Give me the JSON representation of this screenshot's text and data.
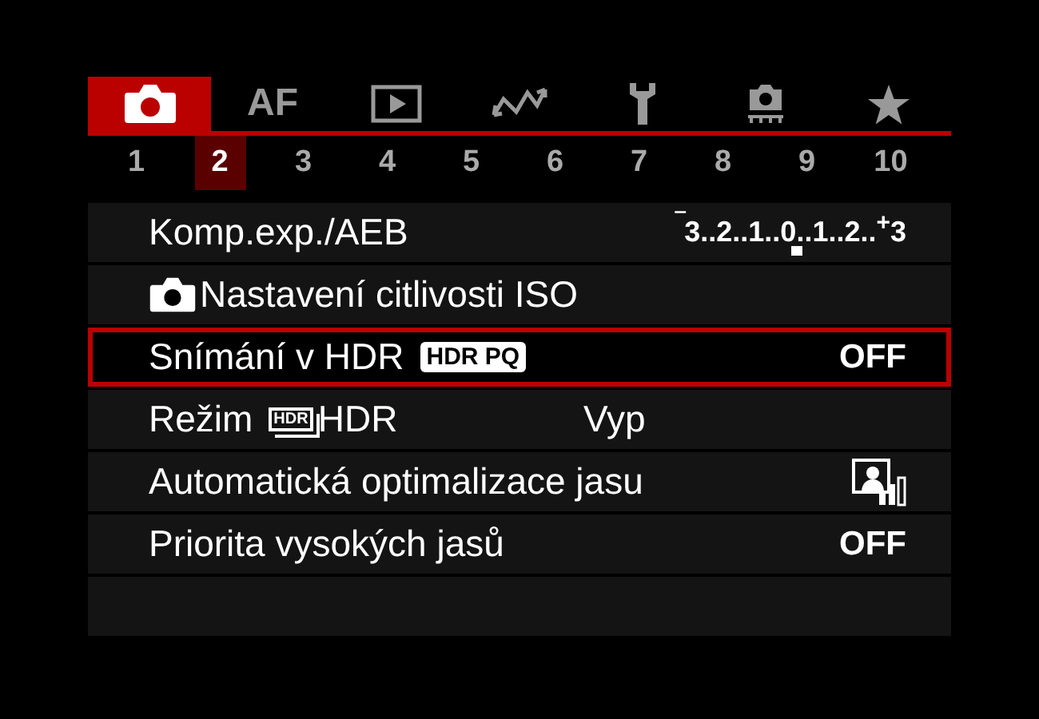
{
  "tabs": [
    {
      "kind": "camera",
      "selected": true
    },
    {
      "kind": "text",
      "label": "AF",
      "selected": false
    },
    {
      "kind": "play",
      "selected": false
    },
    {
      "kind": "wave",
      "selected": false
    },
    {
      "kind": "wrench",
      "selected": false
    },
    {
      "kind": "custom",
      "selected": false
    },
    {
      "kind": "star",
      "selected": false
    }
  ],
  "pages": [
    {
      "label": "1",
      "selected": false
    },
    {
      "label": "2",
      "selected": true
    },
    {
      "label": "3",
      "selected": false
    },
    {
      "label": "4",
      "selected": false
    },
    {
      "label": "5",
      "selected": false
    },
    {
      "label": "6",
      "selected": false
    },
    {
      "label": "7",
      "selected": false
    },
    {
      "label": "8",
      "selected": false
    },
    {
      "label": "9",
      "selected": false
    },
    {
      "label": "10",
      "selected": false
    }
  ],
  "items": [
    {
      "selected": false,
      "parts": [
        {
          "kind": "text",
          "text": "Komp.exp./AEB"
        }
      ],
      "value": {
        "kind": "scale",
        "text": "$^{‾}$3..2..1..0..1..2..$^{+}$3"
      }
    },
    {
      "selected": false,
      "parts": [
        {
          "kind": "camera"
        },
        {
          "kind": "text",
          "text": "Nastavení citlivosti ISO"
        }
      ]
    },
    {
      "selected": true,
      "parts": [
        {
          "kind": "text",
          "text": "Snímání v HDR"
        },
        {
          "kind": "badge",
          "text": "HDR PQ"
        }
      ],
      "value": {
        "kind": "text",
        "text": "OFF"
      }
    },
    {
      "selected": false,
      "parts": [
        {
          "kind": "text",
          "text": "Režim"
        },
        {
          "kind": "hdr",
          "text": "HDR"
        },
        {
          "kind": "text",
          "text": "HDR"
        }
      ],
      "value": {
        "kind": "setting",
        "text": "Vyp"
      }
    },
    {
      "selected": false,
      "parts": [
        {
          "kind": "text",
          "text": "Automatická optimalizace jasu"
        }
      ],
      "value": {
        "kind": "icon"
      }
    },
    {
      "selected": false,
      "parts": [
        {
          "kind": "text",
          "text": "Priorita vysokých jasů"
        }
      ],
      "value": {
        "kind": "text",
        "text": "OFF"
      }
    }
  ]
}
